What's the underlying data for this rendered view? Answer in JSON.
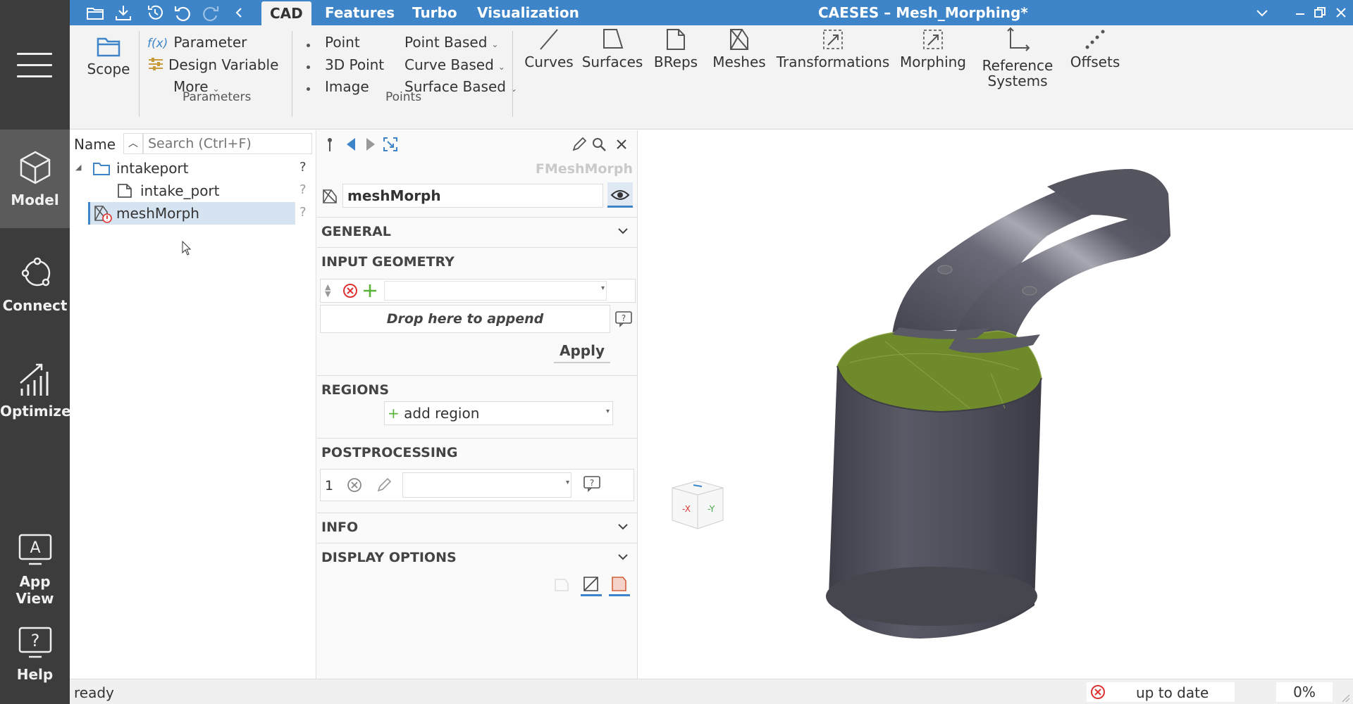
{
  "window": {
    "title": "CAESES – Mesh_Morphing*"
  },
  "tabs": [
    "CAD",
    "Features",
    "Turbo",
    "Visualization"
  ],
  "rail": {
    "items": [
      {
        "label": "Model",
        "icon": "cube-icon"
      },
      {
        "label": "Connect",
        "icon": "connect-icon"
      },
      {
        "label": "Optimize",
        "icon": "chart-icon"
      },
      {
        "label": "App View",
        "icon": "app-view-icon"
      },
      {
        "label": "Help",
        "icon": "help-icon"
      }
    ]
  },
  "ribbon": {
    "scope": "Scope",
    "parameters": {
      "parameter": "Parameter",
      "design_variable": "Design Variable",
      "more": "More",
      "group": "Parameters"
    },
    "points": {
      "point": "Point",
      "point3d": "3D Point",
      "image": "Image",
      "point_based": "Point Based",
      "curve_based": "Curve Based",
      "surface_based": "Surface Based",
      "group": "Points"
    },
    "big": {
      "curves": "Curves",
      "surfaces": "Surfaces",
      "breps": "BReps",
      "meshes": "Meshes",
      "transformations": "Transformations",
      "morphing": "Morphing",
      "reference_systems_1": "Reference",
      "reference_systems_2": "Systems",
      "offsets": "Offsets"
    }
  },
  "tree": {
    "name_header": "Name",
    "search_placeholder": "Search (Ctrl+F)",
    "rows": [
      {
        "label": "intakeport",
        "q": "?"
      },
      {
        "label": "intake_port",
        "q": "?"
      },
      {
        "label": "meshMorph",
        "q": "?"
      }
    ]
  },
  "props": {
    "type": "FMeshMorph",
    "name": "meshMorph",
    "sections": {
      "general": "GENERAL",
      "input_geometry": "INPUT GEOMETRY",
      "regions": "REGIONS",
      "postprocessing": "POSTPROCESSING",
      "info": "INFO",
      "display_options": "DISPLAY OPTIONS"
    },
    "drop_text": "Drop here to append",
    "apply": "Apply",
    "add_region": "add region",
    "post_index": "1"
  },
  "viewcube": {
    "neg_x": "-X",
    "y": "-Y"
  },
  "status": {
    "text": "ready",
    "state": "up to date",
    "progress": "0%"
  },
  "colors": {
    "accent": "#3d85c8",
    "rail": "#3c3c3c",
    "model_body": "#4e4e5a",
    "green_cap": "#6f8a2a"
  }
}
